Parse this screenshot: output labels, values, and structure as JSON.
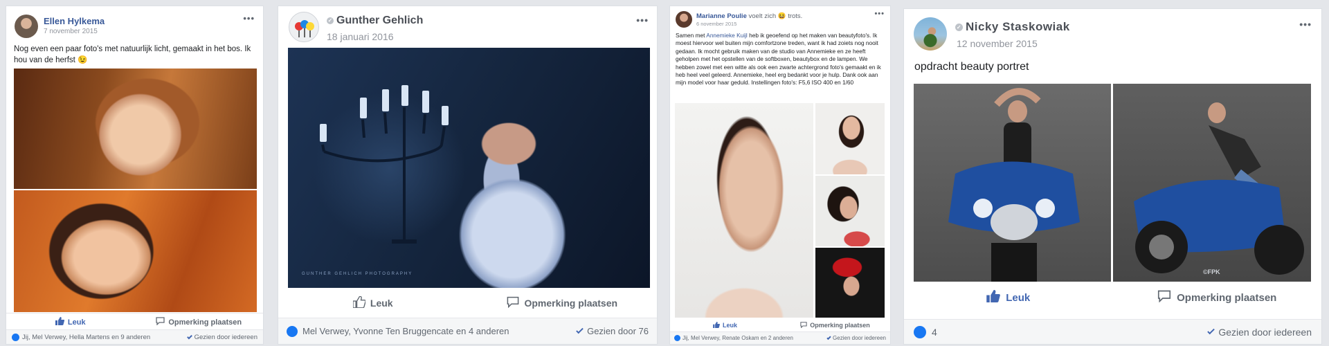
{
  "posts": [
    {
      "author": "Ellen Hylkema",
      "date": "7 november 2015",
      "text": "Nog even een paar foto's met natuurlijk licht, gemaakt in het bos. Ik hou van de herfst 😉",
      "like_label": "Leuk",
      "comment_label": "Opmerking plaatsen",
      "reactions": "Jij, Mel Verwey, Hella Martens en 9 anderen",
      "seen": "Gezien door iedereen"
    },
    {
      "author": "Gunther Gehlich",
      "date": "18 januari 2016",
      "like_label": "Leuk",
      "comment_label": "Opmerking plaatsen",
      "reactions": "Mel Verwey, Yvonne Ten Bruggencate en 4 anderen",
      "seen": "Gezien door 76"
    },
    {
      "author": "Marianne Poulie",
      "feeling": "voelt zich 😆 trots.",
      "date": "6 november 2015",
      "text_intro": "Samen met ",
      "tag": "Annemieke Kuijl",
      "text": " heb ik geoefend op het maken van beautyfoto's. Ik moest hiervoor wel buiten mijn comfortzone treden, want ik had zoiets nog nooit gedaan. Ik mocht gebruik maken van de studio van Annemieke en ze heeft geholpen met het opstellen van de softboxen, beautybox en de lampen. We hebben zowel met een witte als ook een zwarte achtergrond foto's gemaakt en ik heb heel veel geleerd. Annemieke, heel erg bedankt voor je hulp. Dank ook aan mijn model voor haar geduld. Instellingen foto's: F5,6 ISO 400 en 1/60",
      "like_label": "Leuk",
      "comment_label": "Opmerking plaatsen",
      "reactions": "Jij, Mel Verwey, Renate Oskam en 2 anderen",
      "seen": "Gezien door iedereen"
    },
    {
      "author": "Nicky Staskowiak",
      "date": "12 november 2015",
      "text": "opdracht beauty portret",
      "like_label": "Leuk",
      "comment_label": "Opmerking plaatsen",
      "reactions": "4",
      "seen": "Gezien door iedereen",
      "watermark": "©FPK"
    }
  ],
  "icons": {
    "more": "more-dots-icon",
    "like": "thumbs-up-icon",
    "comment": "comment-bubble-icon",
    "seen": "checkmark-icon",
    "verified": "verified-badge-icon"
  },
  "colors": {
    "link": "#385898",
    "like_blue": "#1877f2",
    "muted": "#90949c"
  }
}
